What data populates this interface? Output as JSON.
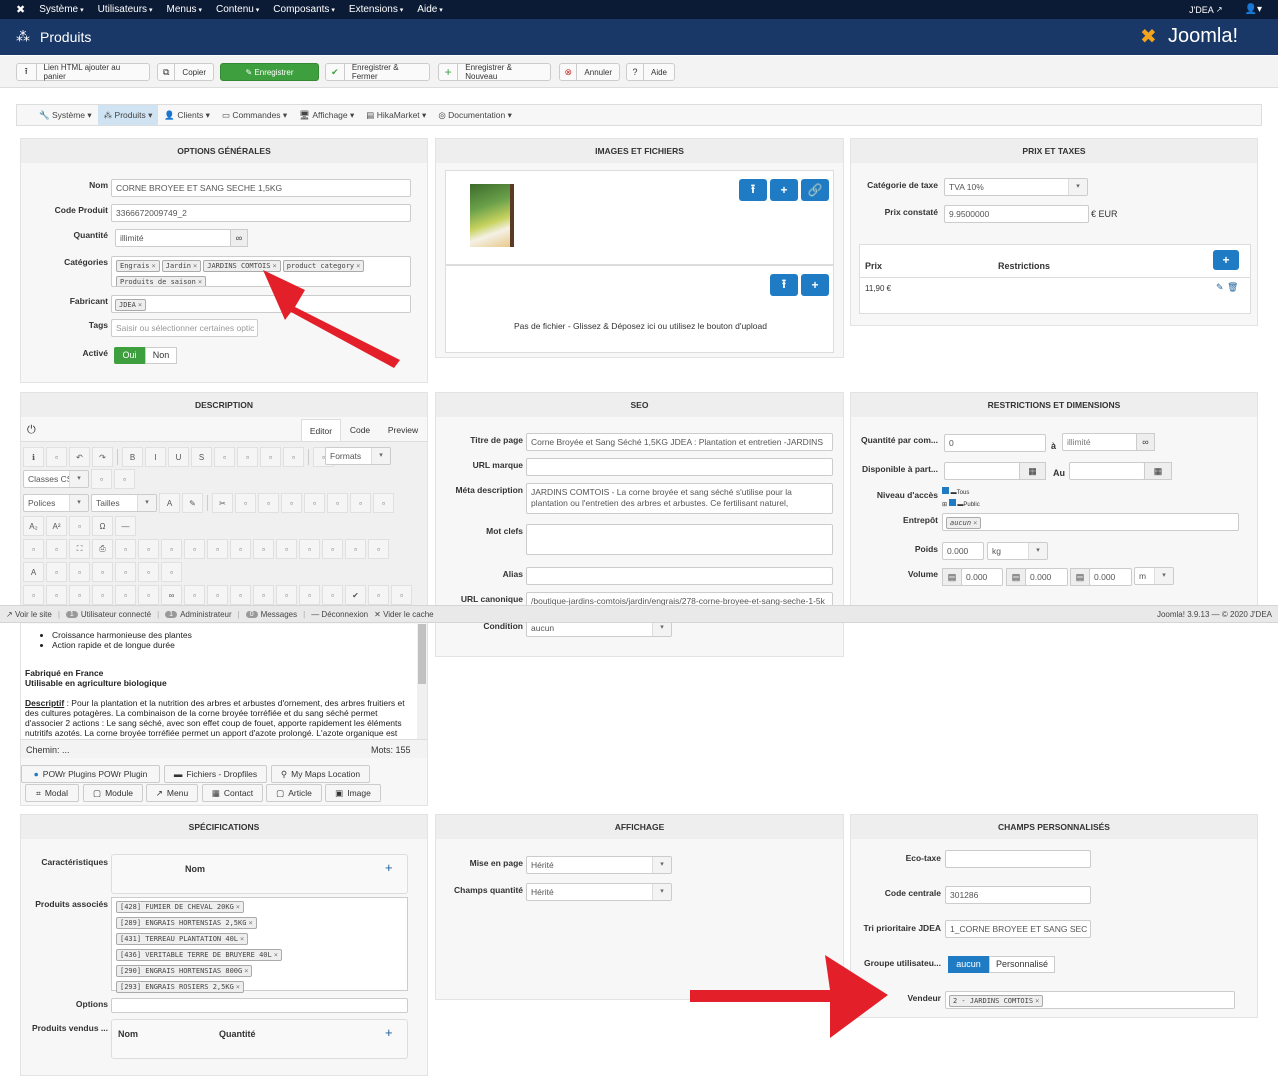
{
  "topbar": {
    "menus": [
      "Système",
      "Utilisateurs",
      "Menus",
      "Contenu",
      "Composants",
      "Extensions",
      "Aide"
    ],
    "site_link": "J'DEA"
  },
  "header": {
    "title": "Produits",
    "logo_text": "Joomla!"
  },
  "toolbar": {
    "buttons": [
      "Lien HTML ajouter au panier",
      "Copier",
      "Enregistrer",
      "Enregistrer & Fermer",
      "Enregistrer & Nouveau",
      "Annuler",
      "Aide"
    ]
  },
  "submenu": {
    "items": [
      "Système",
      "Produits",
      "Clients",
      "Commandes",
      "Affichage",
      "HikaMarket",
      "Documentation"
    ]
  },
  "general": {
    "title": "OPTIONS GÉNÉRALES",
    "labels": {
      "name": "Nom",
      "code": "Code Produit",
      "qty": "Quantité",
      "cats": "Catégories",
      "maker": "Fabricant",
      "tags": "Tags",
      "active": "Activé"
    },
    "name": "CORNE BROYEE ET SANG SECHE 1,5KG",
    "code": "3366672009749_2",
    "qty": "illimité",
    "categories": [
      "Engrais",
      "Jardin",
      "JARDINS COMTOIS",
      "product category",
      "Produits de saison"
    ],
    "maker": "JDEA",
    "tags_placeholder": "Saisir ou sélectionner certaines optic",
    "yes": "Oui",
    "no": "Non"
  },
  "images": {
    "title": "IMAGES ET FICHIERS",
    "no_file": "Pas de fichier - Glissez & Déposez ici ou utilisez le bouton d'upload"
  },
  "price": {
    "title": "PRIX ET TAXES",
    "tax_label": "Catégorie de taxe",
    "tax": "TVA 10%",
    "msrp_label": "Prix constaté",
    "msrp": "9.9500000",
    "currency": "€ EUR",
    "col_price": "Prix",
    "col_restr": "Restrictions",
    "row_price": "11,90 €"
  },
  "description": {
    "title": "DESCRIPTION",
    "tabs": [
      "Editor",
      "Code",
      "Preview"
    ],
    "formats": "Formats",
    "css": "Classes CSS",
    "fonts": "Polices",
    "sizes": "Tailles",
    "bullets": [
      "Croissance harmonieuse des plantes",
      "Action rapide et de longue durée"
    ],
    "bold1": "Fabriqué en France",
    "bold2": "Utilisable en agriculture biologique",
    "desc_label": "Descriptif",
    "desc_text": " : Pour la plantation et la nutrition des arbres et arbustes d'ornement, des arbres fruitiers et des cultures potagères. La combinaison de la corne broyée torréfiée et du sang séché permet d'associer 2 actions : Le sang séché, avec son effet coup de fouet, apporte rapidement les éléments nutritifs azotés. La corne broyée torréfiée permet un apport d'azote prolongé. L'azote organique est",
    "path": "Chemin: ...",
    "words": "Mots: 155",
    "plugins": [
      "POWr Plugins POWr Plugin",
      "Fichiers - Dropfiles",
      "My Maps Location"
    ],
    "inserts": [
      "Modal",
      "Module",
      "Menu",
      "Contact",
      "Article",
      "Image"
    ]
  },
  "seo": {
    "title": "SEO",
    "labels": {
      "page_title": "Titre de page",
      "brand_url": "URL marque",
      "meta": "Méta description",
      "keywords": "Mot clefs",
      "alias": "Alias",
      "canonical": "URL canonique",
      "condition": "Condition"
    },
    "page_title": "Corne Broyée et Sang Séché 1,5KG JDEA : Plantation et entretien -JARDINS",
    "meta": "JARDINS COMTOIS - La corne broyée et sang séché s'utilise pour la plantation ou l'entretien des arbres et arbustes. Ce fertilisant naturel,",
    "canonical": "/boutique-jardins-comtois/jardin/engrais/278-corne-broyee-et-sang-seche-1-5k",
    "condition": "aucun"
  },
  "restrictions": {
    "title": "RESTRICTIONS ET DIMENSIONS",
    "labels": {
      "qty": "Quantité par com...",
      "to": "à",
      "avail": "Disponible à part...",
      "until": "Au",
      "access": "Niveau d'accès",
      "warehouse": "Entrepôt",
      "weight": "Poids",
      "volume": "Volume"
    },
    "qty_min": "0",
    "qty_max": "illimité",
    "access": [
      "Tous",
      "Public"
    ],
    "warehouse": "aucun",
    "weight": "0.000",
    "weight_unit": "kg",
    "volume": [
      "0.000",
      "0.000",
      "0.000"
    ],
    "volume_unit": "m"
  },
  "statusbar": {
    "view_site": "Voir le site",
    "users_count": "1",
    "users": "Utilisateur connecté",
    "admin_count": "1",
    "admin": "Administrateur",
    "msg_count": "0",
    "messages": "Messages",
    "logout": "Déconnexion",
    "clear_cache": "Vider le cache",
    "version": "Joomla! 3.9.13 — © 2020 J'DEA"
  },
  "specs": {
    "title": "SPÉCIFICATIONS",
    "labels": {
      "chars": "Caractéristiques",
      "related": "Produits associés",
      "options": "Options",
      "bundle": "Produits vendus ..."
    },
    "col_name": "Nom",
    "col_qty": "Quantité",
    "related": [
      "[428] FUMIER DE CHEVAL 20KG",
      "[289] ENGRAIS HORTENSIAS 2,5KG",
      "[431] TERREAU PLANTATION 40L",
      "[436] VERITABLE TERRE DE BRUYERE 40L",
      "[290] ENGRAIS HORTENSIAS 800G",
      "[293] ENGRAIS ROSIERS 2,5KG"
    ]
  },
  "display": {
    "title": "AFFICHAGE",
    "layout_label": "Mise en page",
    "layout": "Hérité",
    "qty_label": "Champs quantité",
    "qty": "Hérité"
  },
  "custom": {
    "title": "CHAMPS PERSONNALISÉS",
    "labels": {
      "eco": "Eco-taxe",
      "code": "Code centrale",
      "sort": "Tri prioritaire JDEA",
      "group": "Groupe utilisateu...",
      "vendor": "Vendeur"
    },
    "code": "301286",
    "sort": "1_CORNE BROYEE ET SANG SEC",
    "group_options": [
      "aucun",
      "Personnalisé"
    ],
    "vendor": "2 - JARDINS COMTOIS"
  },
  "colors": {
    "topbar": "#0c1b35",
    "header": "#1a3867",
    "save": "#3e9f3e",
    "primary": "#1f7cc4",
    "arrow": "#e3202a"
  }
}
